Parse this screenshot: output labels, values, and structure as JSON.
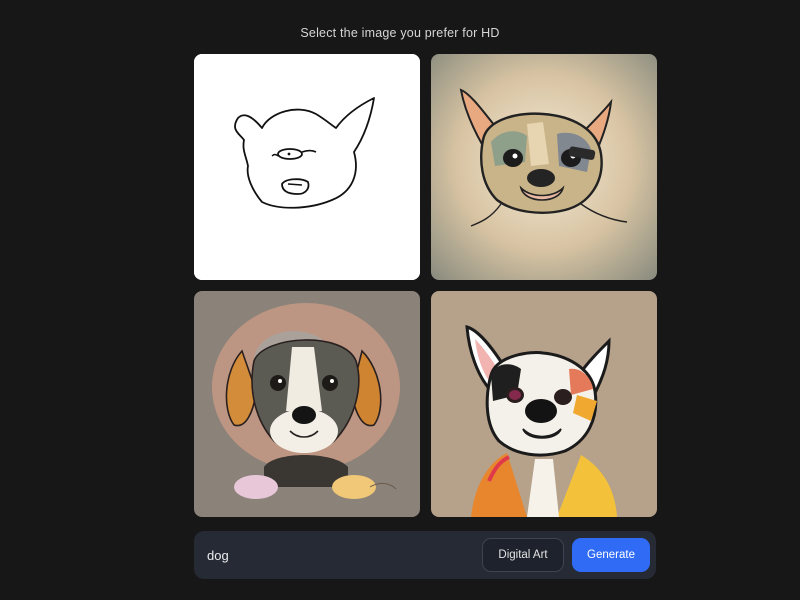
{
  "header": {
    "title": "Select the image you prefer for HD"
  },
  "images": [
    {
      "id": "sketch",
      "background": "#ffffff"
    },
    {
      "id": "french-bulldog-watercolor",
      "background": "#d9c7a8"
    },
    {
      "id": "beagle-puppy-painting",
      "background": "#8a8179"
    },
    {
      "id": "boston-terrier-painting",
      "background": "#b5a089"
    }
  ],
  "prompt": {
    "value": "dog",
    "style_label": "Digital Art",
    "generate_label": "Generate"
  },
  "colors": {
    "page_background": "#171717",
    "prompt_bar": "#262a35",
    "accent": "#2f6bf5"
  }
}
